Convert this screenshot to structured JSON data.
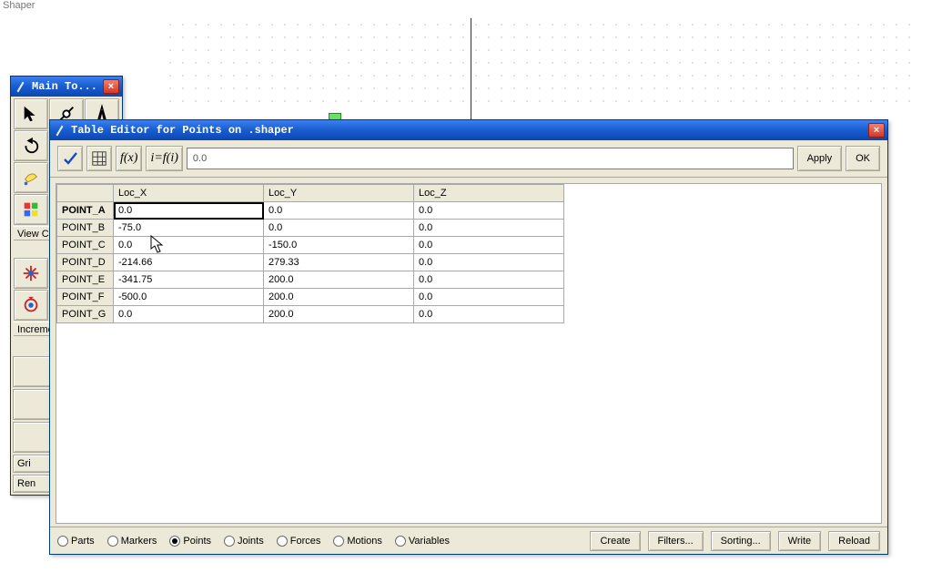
{
  "workspace_label": "Shaper",
  "palette": {
    "title": "Main To...",
    "section1": "View C",
    "section2": "Increme",
    "btn_grid": "Gri",
    "btn_render": "Ren"
  },
  "editor": {
    "title": "Table Editor for Points on .shaper",
    "value_field": "0.0",
    "apply": "Apply",
    "ok": "OK",
    "fx": "f(x)",
    "fi": "i=f(i)",
    "columns": {
      "x": "Loc_X",
      "y": "Loc_Y",
      "z": "Loc_Z"
    },
    "rows": [
      {
        "name": "POINT_A",
        "x": "0.0",
        "y": "0.0",
        "z": "0.0",
        "selected": true
      },
      {
        "name": "POINT_B",
        "x": "-75.0",
        "y": "0.0",
        "z": "0.0"
      },
      {
        "name": "POINT_C",
        "x": "0.0",
        "y": "-150.0",
        "z": "0.0"
      },
      {
        "name": "POINT_D",
        "x": "-214.66",
        "y": "279.33",
        "z": "0.0"
      },
      {
        "name": "POINT_E",
        "x": "-341.75",
        "y": "200.0",
        "z": "0.0"
      },
      {
        "name": "POINT_F",
        "x": "-500.0",
        "y": "200.0",
        "z": "0.0"
      },
      {
        "name": "POINT_G",
        "x": "0.0",
        "y": "200.0",
        "z": "0.0"
      }
    ],
    "filters": {
      "parts": "Parts",
      "markers": "Markers",
      "points": "Points",
      "joints": "Joints",
      "forces": "Forces",
      "motions": "Motions",
      "variables": "Variables",
      "selected": "points"
    },
    "footer_buttons": {
      "create": "Create",
      "filters": "Filters...",
      "sorting": "Sorting...",
      "write": "Write",
      "reload": "Reload"
    }
  }
}
